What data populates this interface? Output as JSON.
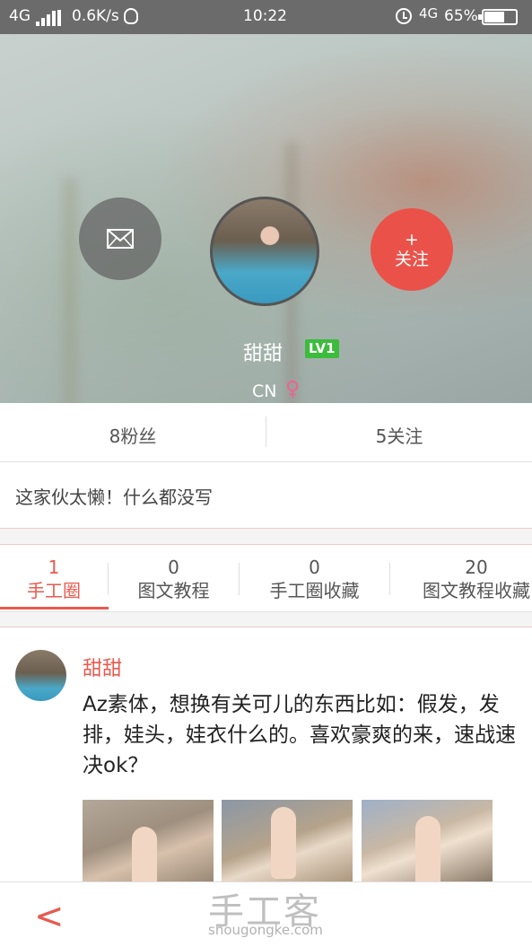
{
  "status_bar": {
    "network_left": "4G",
    "speed": "0.6K/s",
    "time": "10:22",
    "network_right": "4G",
    "battery": "65%",
    "battery_level": 0.65
  },
  "profile": {
    "name": "甜甜",
    "level": "LV1",
    "country": "CN",
    "gender_symbol": "♀",
    "follow_plus": "+",
    "follow_label": "关注",
    "message_icon": "envelope-icon"
  },
  "stats": {
    "fans": "8粉丝",
    "following": "5关注"
  },
  "bio": "这家伙太懒！什么都没写",
  "tabs": [
    {
      "count": "1",
      "label": "手工圈"
    },
    {
      "count": "0",
      "label": "图文教程"
    },
    {
      "count": "0",
      "label": "手工圈收藏"
    },
    {
      "count": "20",
      "label": "图文教程收藏"
    }
  ],
  "post": {
    "author": "甜甜",
    "text": "Az素体，想换有关可儿的东西比如：假发，发排，娃头，娃衣什么的。喜欢豪爽的来，速战速决ok？"
  },
  "footer": {
    "back_icon": "<",
    "watermark_cn": "手工客",
    "watermark_en": "shougongke.com"
  },
  "colors": {
    "accent": "#e85a4f",
    "level_badge": "#3cbc3c"
  }
}
